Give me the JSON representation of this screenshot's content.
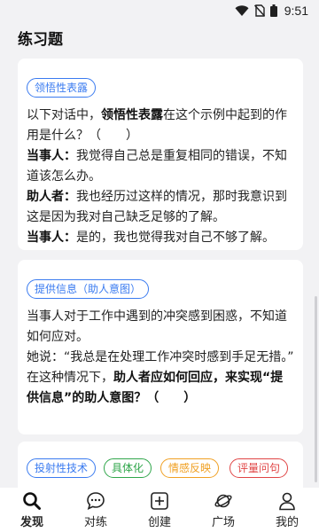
{
  "status_bar": {
    "time": "9:51"
  },
  "page": {
    "title": "练习题"
  },
  "cards": [
    {
      "tag": "领悟性表露",
      "q_pre": "以下对话中，",
      "q_bold": "领悟性表露",
      "q_post": "在这个示例中起到的作用是什么？（　　）",
      "lines": [
        {
          "speaker": "当事人：",
          "text": "我觉得自己总是重复相同的错误，不知道该怎么办。"
        },
        {
          "speaker": "助人者：",
          "text": "我也经历过这样的情况，那时我意识到这是因为我对自己缺乏足够的了解。"
        },
        {
          "speaker": "当事人：",
          "text": "是的，我也觉得我对自己不够了解。"
        }
      ]
    },
    {
      "tag": "提供信息（助人意图）",
      "p1": "当事人对于工作中遇到的冲突感到困惑，不知道如何应对。",
      "p2": "她说：“我总是在处理工作冲突时感到手足无措。”",
      "p3_pre": "在这种情况下，",
      "p3_bold": "助人者应如何回应，来实现“提供信息”的助人意图？（　　）"
    },
    {
      "tags": [
        "投射性技术",
        "具体化",
        "情感反映",
        "评量问句"
      ]
    }
  ],
  "nav": [
    {
      "label": "发现",
      "icon": "search-icon"
    },
    {
      "label": "对练",
      "icon": "chat-icon"
    },
    {
      "label": "创建",
      "icon": "add-square-icon"
    },
    {
      "label": "广场",
      "icon": "planet-icon"
    },
    {
      "label": "我的",
      "icon": "person-icon"
    }
  ]
}
